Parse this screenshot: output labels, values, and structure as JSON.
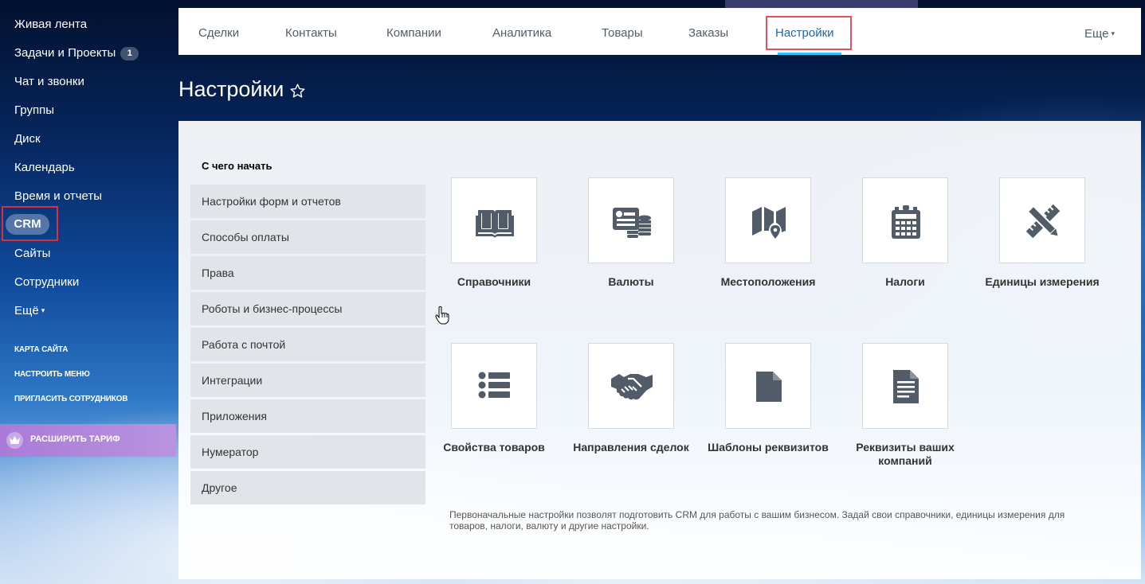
{
  "left_menu": {
    "items": [
      {
        "label": "Живая лента"
      },
      {
        "label": "Задачи и Проекты",
        "counter": "1"
      },
      {
        "label": "Чат и звонки"
      },
      {
        "label": "Группы"
      },
      {
        "label": "Диск"
      },
      {
        "label": "Календарь"
      },
      {
        "label": "Время и отчеты"
      },
      {
        "label": "CRM",
        "active": true
      },
      {
        "label": "Сайты"
      },
      {
        "label": "Сотрудники"
      },
      {
        "label": "Ещё"
      }
    ],
    "links": [
      "Карта сайта",
      "Настроить меню",
      "Пригласить сотрудников"
    ],
    "upgrade_label": "Расширить тариф"
  },
  "top_nav": {
    "tabs": [
      "Сделки",
      "Контакты",
      "Компании",
      "Аналитика",
      "Товары",
      "Заказы",
      "Настройки"
    ],
    "active_tab": "Настройки",
    "more_label": "Еще"
  },
  "page": {
    "title": "Настройки"
  },
  "settings": {
    "section_title": "С чего начать",
    "sidebar_items": [
      "Настройки форм и отчетов",
      "Способы оплаты",
      "Права",
      "Роботы и бизнес-процессы",
      "Работа с почтой",
      "Интеграции",
      "Приложения",
      "Нумератор",
      "Другое"
    ],
    "tiles": [
      {
        "label": "Справочники",
        "icon": "book-icon"
      },
      {
        "label": "Валюты",
        "icon": "currency-icon"
      },
      {
        "label": "Местоположения",
        "icon": "map-icon"
      },
      {
        "label": "Налоги",
        "icon": "calculator-icon"
      },
      {
        "label": "Единицы измерения",
        "icon": "ruler-pencil-icon"
      },
      {
        "label": "Свойства товаров",
        "icon": "list-icon"
      },
      {
        "label": "Направления сделок",
        "icon": "handshake-icon"
      },
      {
        "label": "Шаблоны реквизитов",
        "icon": "file-icon"
      },
      {
        "label": "Реквизиты ваших компаний",
        "icon": "document-icon"
      }
    ],
    "description": "Первоначальные настройки позволят подготовить CRM для работы с вашим бизнесом. Задай свои справочники, единицы измерения для товаров, налоги, валюту и другие настройки."
  },
  "colors": {
    "active_tab": "#2067b0",
    "highlight_frame": "#d6313f",
    "icon": "#525c69",
    "upgrade_bg": "#b28ad9"
  }
}
